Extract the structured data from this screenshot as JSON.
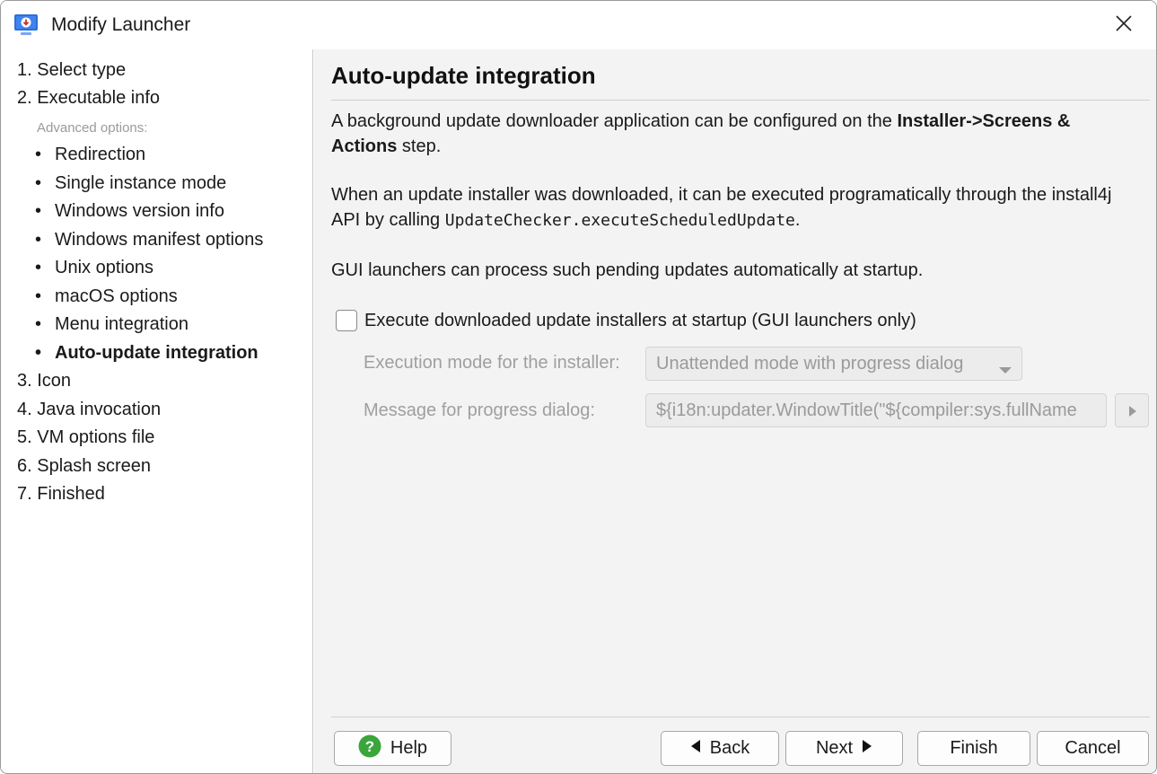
{
  "window": {
    "title": "Modify Launcher",
    "app_icon": "download-monitor-icon",
    "close_icon": "close-icon"
  },
  "sidebar": {
    "steps_before": [
      {
        "label": "1. Select type"
      },
      {
        "label": "2. Executable info"
      }
    ],
    "advanced_label": "Advanced options:",
    "sub_items": [
      {
        "label": "Redirection"
      },
      {
        "label": "Single instance mode"
      },
      {
        "label": "Windows version info"
      },
      {
        "label": "Windows manifest options"
      },
      {
        "label": "Unix options"
      },
      {
        "label": "macOS options"
      },
      {
        "label": "Menu integration"
      },
      {
        "label": "Auto-update integration",
        "active": true
      }
    ],
    "bullet": "•",
    "steps_after": [
      {
        "label": "3. Icon"
      },
      {
        "label": "4. Java invocation"
      },
      {
        "label": "5. VM options file"
      },
      {
        "label": "6. Splash screen"
      },
      {
        "label": "7. Finished"
      }
    ]
  },
  "content": {
    "heading": "Auto-update integration",
    "para1": {
      "before": "A background update downloader application can be configured on the ",
      "bold": "Installer->Screens & Actions",
      "after": " step."
    },
    "para2": {
      "before": "When an update installer was downloaded, it can be executed programatically through the install4j API by calling ",
      "code": "UpdateChecker.executeScheduledUpdate",
      "after": "."
    },
    "para3": "GUI launchers can process such pending updates automatically at startup.",
    "checkbox": {
      "label": "Execute downloaded update installers at startup (GUI launchers only)",
      "checked": false
    },
    "execution_mode": {
      "label": "Execution mode for the installer:",
      "value": "Unattended mode with progress dialog",
      "enabled": false
    },
    "progress_message": {
      "label": "Message for progress dialog:",
      "value": "${i18n:updater.WindowTitle(\"${compiler:sys.fullName",
      "enabled": false
    }
  },
  "buttons": {
    "help": "Help",
    "back": "Back",
    "next": "Next",
    "finish": "Finish",
    "cancel": "Cancel"
  },
  "colors": {
    "help_icon": "#3aa53a",
    "app_icon": "#2f6fd6",
    "disabled_text": "#9f9f9f"
  }
}
